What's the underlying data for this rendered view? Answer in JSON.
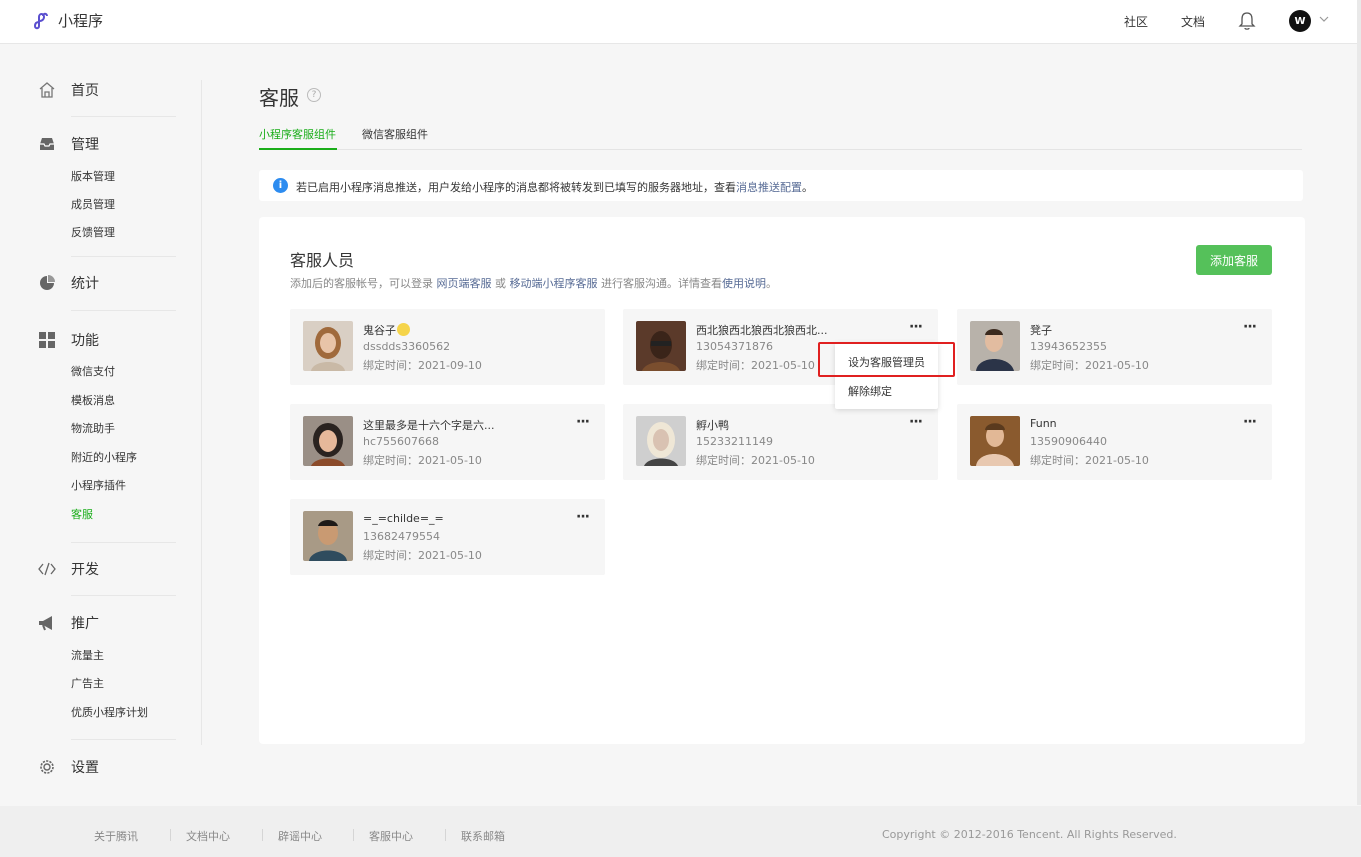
{
  "topbar": {
    "app_name": "小程序",
    "links": [
      "社区",
      "文档"
    ],
    "avatar_text": "W"
  },
  "sidebar": {
    "home": "首页",
    "manage": {
      "label": "管理",
      "items": [
        "版本管理",
        "成员管理",
        "反馈管理"
      ]
    },
    "stats": "统计",
    "features": {
      "label": "功能",
      "items": [
        "微信支付",
        "模板消息",
        "物流助手",
        "附近的小程序",
        "小程序插件",
        "客服"
      ],
      "active": "客服"
    },
    "develop": "开发",
    "promote": {
      "label": "推广",
      "items": [
        "流量主",
        "广告主",
        "优质小程序计划"
      ]
    },
    "settings": "设置"
  },
  "page": {
    "title": "客服",
    "help": "?",
    "tabs": [
      "小程序客服组件",
      "微信客服组件"
    ],
    "notice": {
      "text": "若已启用小程序消息推送，用户发给小程序的消息都将被转发到已填写的服务器地址，查看",
      "link": "消息推送配置",
      "suffix": "。"
    }
  },
  "panel": {
    "title": "客服人员",
    "desc_prefix": "添加后的客服帐号，可以登录 ",
    "desc_link1": "网页端客服",
    "desc_or": " 或 ",
    "desc_link2": "移动端小程序客服",
    "desc_mid": " 进行客服沟通。详情查看",
    "desc_link3": "使用说明",
    "desc_suffix": "。",
    "add_button": "添加客服"
  },
  "agents": [
    {
      "name": "鬼谷子",
      "id": "dssdds3360562",
      "bind": "绑定时间：2021-09-10"
    },
    {
      "name": "西北狼西北狼西北狼西北...",
      "id": "13054371876",
      "bind": "绑定时间：2021-05-10"
    },
    {
      "name": "凳子",
      "id": "13943652355",
      "bind": "绑定时间：2021-05-10"
    },
    {
      "name": "这里最多是十六个字是六...",
      "id": "hc755607668",
      "bind": "绑定时间：2021-05-10"
    },
    {
      "name": "孵小鸭",
      "id": "15233211149",
      "bind": "绑定时间：2021-05-10"
    },
    {
      "name": "Funn",
      "id": "13590906440",
      "bind": "绑定时间：2021-05-10"
    },
    {
      "name": "=_=childe=_=",
      "id": "13682479554",
      "bind": "绑定时间：2021-05-10"
    }
  ],
  "more_label": "···",
  "menu": {
    "items": [
      "设为客服管理员",
      "解除绑定"
    ]
  },
  "footer": {
    "links": [
      "关于腾讯",
      "文档中心",
      "辟谣中心",
      "客服中心",
      "联系邮箱"
    ],
    "copyright": "Copyright © 2012-2016 Tencent. All Rights Reserved."
  }
}
